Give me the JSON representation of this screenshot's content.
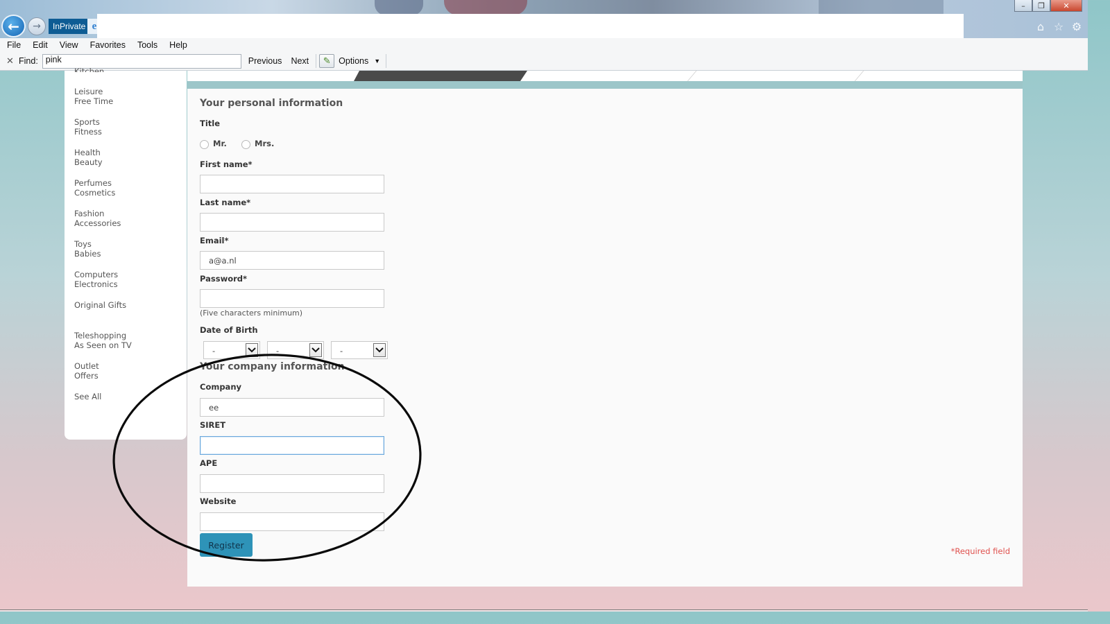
{
  "browser": {
    "inprivate_label": "InPrivate",
    "menu": [
      "File",
      "Edit",
      "View",
      "Favorites",
      "Tools",
      "Help"
    ],
    "find": {
      "label": "Find:",
      "value": "pink",
      "previous": "Previous",
      "next": "Next",
      "options": "Options"
    }
  },
  "sidebar": {
    "categories": [
      "Kitchen",
      "Leisure\nFree Time",
      "Sports\nFitness",
      "Health\nBeauty",
      "Perfumes\nCosmetics",
      "Fashion\nAccessories",
      "Toys\nBabies",
      "Computers\nElectronics",
      "Original Gifts",
      "Teleshopping\nAs Seen on TV",
      "Outlet\nOffers",
      "See All"
    ]
  },
  "form": {
    "personal_title": "Your personal information",
    "title_label": "Title",
    "title_options": [
      "Mr.",
      "Mrs."
    ],
    "first_name_label": "First name*",
    "first_name_value": "",
    "last_name_label": "Last name*",
    "last_name_value": "",
    "email_label": "Email*",
    "email_value": "a@a.nl",
    "password_label": "Password*",
    "password_hint": "(Five characters minimum)",
    "dob_label": "Date of Birth",
    "dob_values": [
      "-",
      "-",
      "-"
    ],
    "company_title": "Your company information",
    "company_label": "Company",
    "company_value": "ee",
    "siret_label": "SIRET",
    "ape_label": "APE",
    "website_label": "Website",
    "register_label": "Register",
    "required_note": "*Required field"
  },
  "icons": {
    "back": "back-arrow-icon",
    "forward": "forward-arrow-icon",
    "home": "home-icon",
    "favorites": "star-icon",
    "settings": "gear-icon",
    "find_close": "close-icon",
    "find_options": "pencil-icon"
  },
  "colors": {
    "accent_button": "#2e93b8",
    "required_red": "#e0524f",
    "browser_blue": "#0e5c94"
  }
}
